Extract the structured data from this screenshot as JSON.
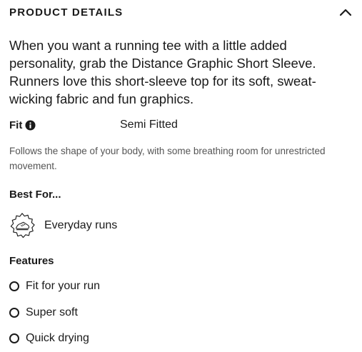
{
  "section": {
    "title": "PRODUCT DETAILS",
    "collapse_icon": "chevron-up-icon"
  },
  "description": "When you want a running tee with a little added personality, grab the Distance Graphic Short Sleeve. Runners love this short-sleeve top for its soft, sweat-wicking fabric and fun graphics.",
  "fit": {
    "label": "Fit",
    "info_icon": "info-icon",
    "value": "Semi Fitted",
    "note": "Follows the shape of your body, with some breathing room for unrestricted movement."
  },
  "best_for": {
    "title": "Best For...",
    "items": [
      {
        "icon": "running-shoe-badge-icon",
        "label": "Everyday runs"
      }
    ]
  },
  "features": {
    "title": "Features",
    "items": [
      {
        "label": "Fit for your run"
      },
      {
        "label": "Super soft"
      },
      {
        "label": "Quick drying"
      }
    ]
  }
}
